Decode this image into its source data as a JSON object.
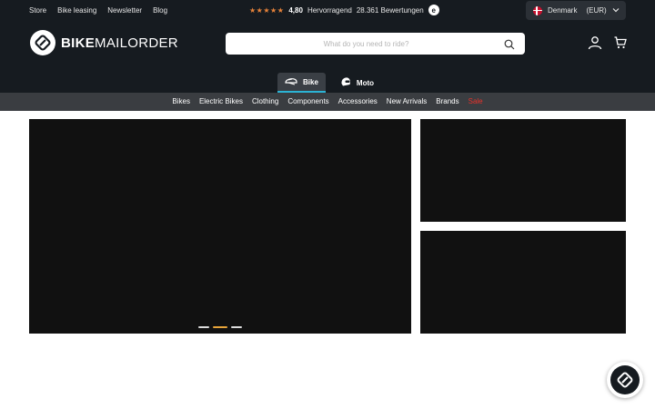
{
  "topbar": {
    "links": [
      "Store",
      "Bike leasing",
      "Newsletter",
      "Blog"
    ],
    "rating": {
      "stars": "★★★★★",
      "score": "4,80",
      "label": "Hervorragend",
      "reviews": "28.361 Bewertungen",
      "badge": "e"
    },
    "country": {
      "name": "Denmark",
      "currency": "(EUR)",
      "chevron": "⌄"
    }
  },
  "logo": {
    "bold": "BIKE",
    "regular": "MAILORDER"
  },
  "search": {
    "placeholder": "What do you need to ride?"
  },
  "mode_tabs": [
    {
      "label": "Bike",
      "icon": "helmet-icon",
      "active": true
    },
    {
      "label": "Moto",
      "icon": "moto-helmet-icon",
      "active": false
    }
  ],
  "nav": {
    "items": [
      "Bikes",
      "Electric Bikes",
      "Clothing",
      "Components",
      "Accessories",
      "New Arrivals",
      "Brands"
    ],
    "sale": "Sale"
  },
  "carousel": {
    "slides": 3,
    "active_index": 1
  },
  "colors": {
    "header": "#161b20",
    "nav": "#3a3d41",
    "accent": "#2bb3d4",
    "sale": "#e8322b",
    "stars": "#e8833a"
  }
}
